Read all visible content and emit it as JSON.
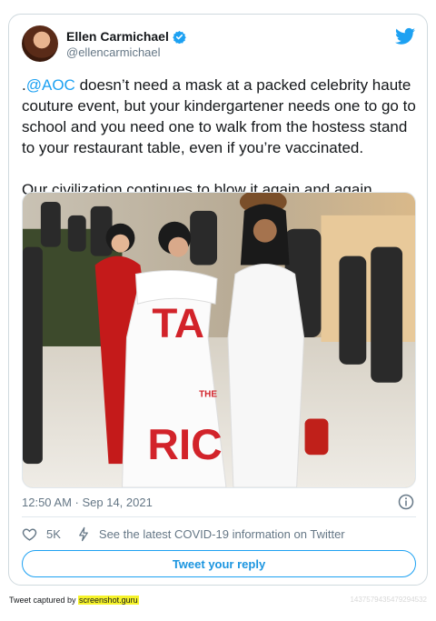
{
  "author": {
    "display_name": "Ellen Carmichael",
    "handle": "@ellencarmichael"
  },
  "tweet": {
    "mention": "@AOC",
    "lead": ".",
    "text_after_mention": " doesn’t need a mask at a packed celebrity haute couture event, but your kindergartener needs one to go to school and you need one to walk from the hostess stand to your restaurant table, even if you’re vaccinated.",
    "text_second": "Our civilization continues to blow it again and again.",
    "timestamp": "12:50 AM · Sep 14, 2021"
  },
  "photo": {
    "dress_text_1": "TA",
    "dress_text_2": "THE",
    "dress_text_3": "RIC"
  },
  "actions": {
    "like_count": "5K",
    "covid_info": "See the latest COVID-19 information on Twitter",
    "reply_label": "Tweet your reply"
  },
  "footer": {
    "prefix": "Tweet captured by ",
    "brand": "screenshot.guru",
    "id": "1437579435479294532"
  },
  "colors": {
    "accent": "#1da1f2",
    "border": "#cfd9de",
    "muted": "#657786"
  },
  "icons": [
    "verified-badge-icon",
    "twitter-bird-icon",
    "info-icon",
    "heart-icon",
    "lightning-bolt-icon"
  ]
}
